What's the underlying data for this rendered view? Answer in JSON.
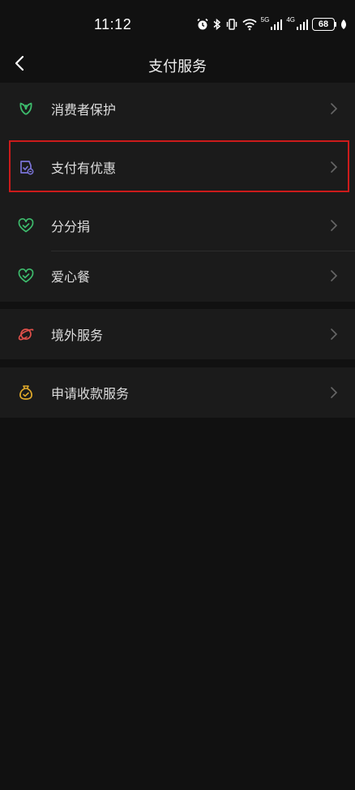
{
  "status_bar": {
    "time": "11:12",
    "net_5g": "5G",
    "net_4g": "4G",
    "battery": "68"
  },
  "nav": {
    "title": "支付服务"
  },
  "groups": [
    {
      "items": [
        {
          "label": "消费者保护",
          "icon": "leaf-shield-icon",
          "color": "#3dbb6c"
        },
        {
          "label": "支付有优惠",
          "icon": "discount-bag-icon",
          "color": "#7b74d8"
        },
        {
          "label": "分分捐",
          "icon": "heart-check-icon",
          "color": "#3dbb6c"
        },
        {
          "label": "爱心餐",
          "icon": "heart-check-icon",
          "color": "#3dbb6c"
        }
      ]
    },
    {
      "items": [
        {
          "label": "境外服务",
          "icon": "planet-icon",
          "color": "#e0504a"
        }
      ]
    },
    {
      "items": [
        {
          "label": "申请收款服务",
          "icon": "money-bag-icon",
          "color": "#e0a92a"
        }
      ]
    }
  ],
  "colors": {
    "background": "#111111",
    "card": "#1b1b1b",
    "highlight": "#cc1b1b"
  }
}
